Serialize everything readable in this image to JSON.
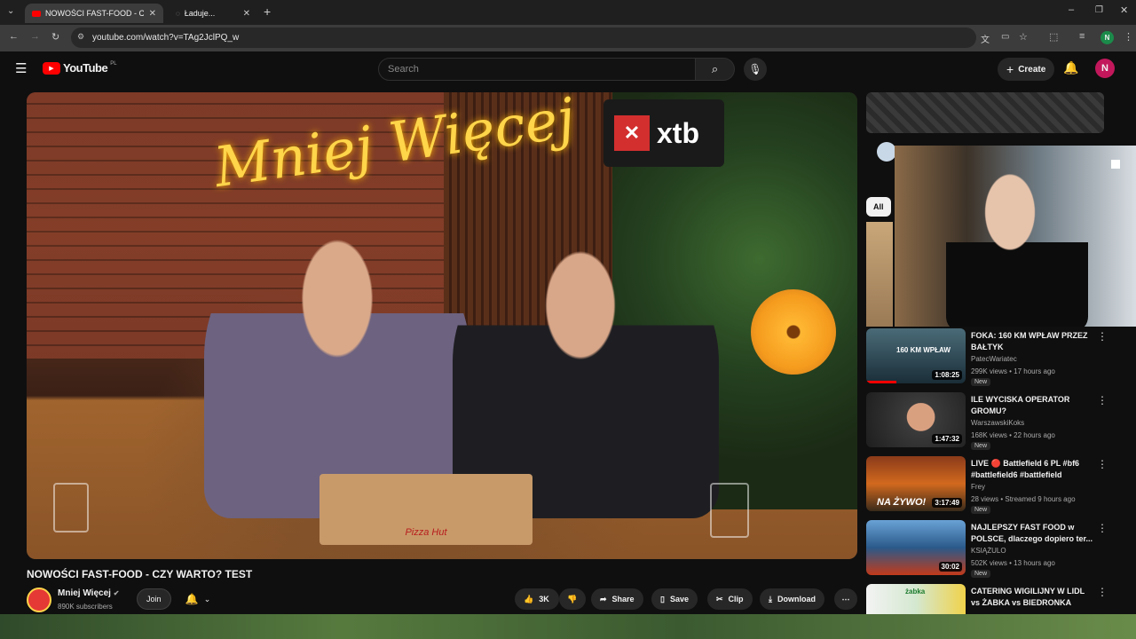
{
  "browser": {
    "tabs": [
      {
        "title": "NOWOŚCI FAST-FOOD - CZY W",
        "active": true
      },
      {
        "title": "Ładuje...",
        "active": false
      }
    ],
    "url": "youtube.com/watch?v=TAg2JclPQ_w",
    "profile_initial": "N"
  },
  "youtube": {
    "logo_text": "YouTube",
    "region": "PL",
    "search_placeholder": "Search",
    "create_label": "Create",
    "avatar_initial": "N"
  },
  "video": {
    "title": "NOWOŚCI FAST-FOOD - CZY WARTO? TEST",
    "overlay_text_neon": "Mniej Więcej",
    "overlay_text_sponsor": "xtb",
    "overlay_box_text": "Pizza Hut",
    "channel_name": "Mniej Więcej",
    "subscribers": "890K subscribers",
    "join_label": "Join",
    "likes": "3K",
    "share_label": "Share",
    "save_label": "Save",
    "clip_label": "Clip",
    "download_label": "Download"
  },
  "sidebar": {
    "chip_all": "All",
    "recommendations": [
      {
        "title": "FOKA: 160 KM WPŁAW PRZEZ BAŁTYK",
        "channel": "PatecWariatec",
        "meta": "299K views • 17 hours ago",
        "badge": "New",
        "duration": "1:08:25",
        "thumb_text": "160 KM WPŁAW"
      },
      {
        "title": "ILE WYCISKA OPERATOR GROMU?",
        "channel": "WarszawskiKoks",
        "meta": "168K views • 22 hours ago",
        "badge": "New",
        "duration": "1:47:32",
        "thumb_text": ""
      },
      {
        "title": "LIVE 🔴 Battlefield 6 PL #bf6 #battlefield6 #battlefield",
        "channel": "Frey",
        "meta": "28 views • Streamed 9 hours ago",
        "badge": "New",
        "duration": "3:17:49",
        "thumb_text": "NA ŻYWO!"
      },
      {
        "title": "NAJLEPSZY FAST FOOD w POLSCE, dlaczego dopiero ter...",
        "channel": "KSIĄŻULO",
        "meta": "502K views • 13 hours ago",
        "badge": "New",
        "duration": "30:02",
        "thumb_text": ""
      },
      {
        "title": "CATERING WIGILIJNY W LIDL vs ŻABKA vs BIEDRONKA",
        "channel": "",
        "meta": "",
        "badge": "",
        "duration": "",
        "thumb_text": "żabka"
      }
    ]
  },
  "colors": {
    "youtube_red": "#ff0000",
    "accent_pink": "#c2185b"
  }
}
